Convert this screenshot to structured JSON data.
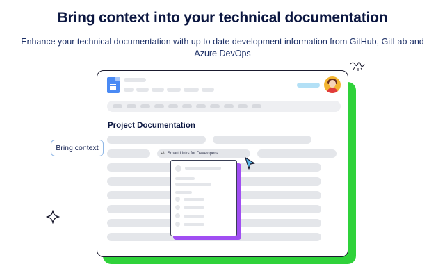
{
  "headline": "Bring context into your technical documentation",
  "subheadline": "Enhance your technical documentation with up to date development information from GitHub, GitLab and Azure DevOps",
  "document": {
    "title": "Project Documentation",
    "smart_link_label": "Smart Links for Developers",
    "smart_link_icon": "smart-links-icon",
    "app_icon": "google-docs-icon",
    "avatar": "user-avatar"
  },
  "callout": {
    "label": "Bring context"
  },
  "colors": {
    "accent_green": "#2fd23a",
    "accent_purple": "#a04ef2",
    "doc_blue": "#4a8af4",
    "callout_border": "#8fb7e6"
  }
}
